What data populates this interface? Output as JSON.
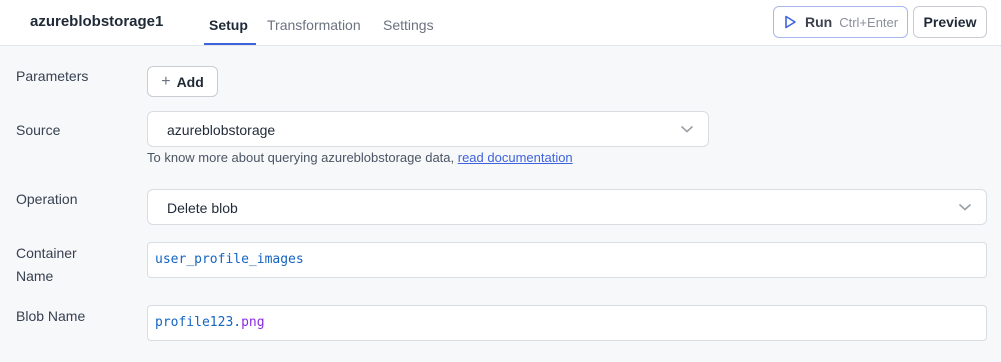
{
  "header": {
    "query_name": "azureblobstorage1",
    "tabs": [
      {
        "label": "Setup",
        "active": true
      },
      {
        "label": "Transformation",
        "active": false
      },
      {
        "label": "Settings",
        "active": false
      }
    ],
    "run_label": "Run",
    "run_shortcut": "Ctrl+Enter",
    "preview_label": "Preview"
  },
  "form": {
    "parameters_label": "Parameters",
    "add_label": "Add",
    "source_label": "Source",
    "source_value": "azureblobstorage",
    "helper_text": "To know more about querying azureblobstorage data, ",
    "helper_link": "read documentation",
    "operation_label": "Operation",
    "operation_value": "Delete blob",
    "container_label_line1": "Container",
    "container_label_line2": "Name",
    "container_value": "user_profile_images",
    "blob_label": "Blob Name",
    "blob_value_base": "profile123.",
    "blob_value_ext": "png"
  },
  "colors": {
    "accent": "#3e63dd",
    "input_text": "#1565c0",
    "extension_text": "#8a2be2"
  },
  "icons": {
    "run": "play-icon",
    "add": "plus-icon",
    "dropdown": "chevron-down-icon"
  }
}
